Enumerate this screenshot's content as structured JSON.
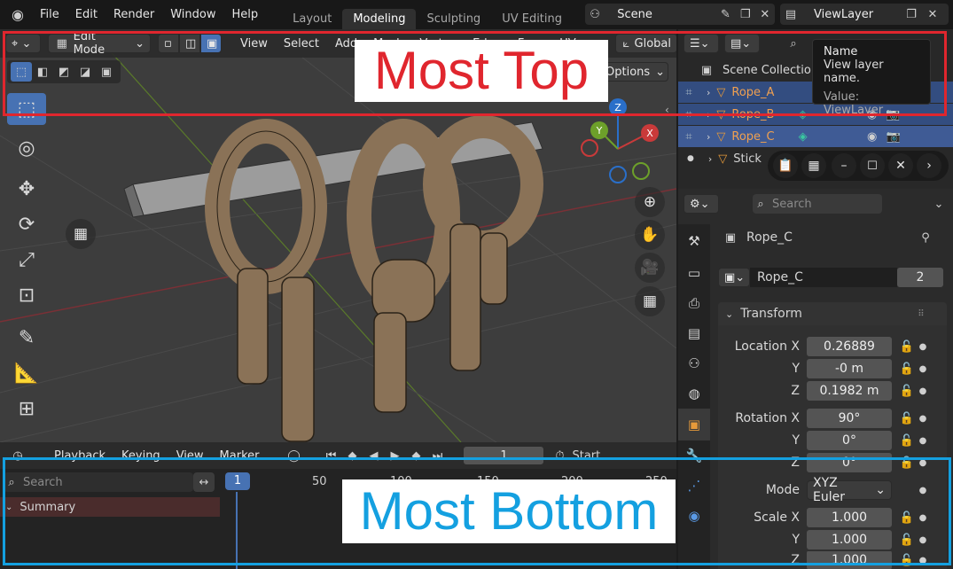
{
  "topbar": {
    "menus": [
      "File",
      "Edit",
      "Render",
      "Window",
      "Help"
    ],
    "workspace_tabs": [
      "Layout",
      "Modeling",
      "Sculpting",
      "UV Editing"
    ],
    "active_tab": "Modeling",
    "scene_name": "Scene",
    "view_layer_name": "ViewLayer"
  },
  "viewport_header": {
    "mode": "Edit Mode",
    "menus": [
      "View",
      "Select",
      "Add",
      "Mesh",
      "Vertex",
      "Edge",
      "Face",
      "UV"
    ],
    "transform_orientation": "Global",
    "options_label": "Options"
  },
  "annotations": {
    "top_label": "Most Top",
    "bottom_label": "Most Bottom",
    "top_color": "#e0262e",
    "bottom_color": "#14a0e0"
  },
  "timeline": {
    "menus": [
      "Playback",
      "Keying",
      "View",
      "Marker"
    ],
    "current_frame": "1",
    "start_label": "Start",
    "search_placeholder": "Search",
    "summary_label": "Summary",
    "ruler": [
      "1",
      "50",
      "100",
      "150",
      "200",
      "250"
    ]
  },
  "outliner": {
    "scene_collection": "Scene Collection",
    "items": [
      {
        "name": "Rope_A",
        "selected": true
      },
      {
        "name": "Rope_B",
        "selected": true
      },
      {
        "name": "Rope_C",
        "selected": true,
        "active": true
      },
      {
        "name": "Stick",
        "selected": false
      }
    ],
    "tooltip": {
      "title": "Name",
      "description": "View layer name.",
      "value": "Value: ViewLayer"
    }
  },
  "properties": {
    "search_placeholder": "Search",
    "object_name": "Rope_C",
    "mesh_name": "Rope_C",
    "mesh_users": "2",
    "panel_title": "Transform",
    "location": {
      "label_x": "Location X",
      "x": "0.26889",
      "y": "-0 m",
      "z": "0.1982 m"
    },
    "rotation": {
      "label_x": "Rotation X",
      "x": "90°",
      "y": "0°",
      "z": "0°"
    },
    "mode_label": "Mode",
    "mode_value": "XYZ Euler",
    "scale": {
      "label_x": "Scale X",
      "x": "1.000",
      "y": "1.000",
      "z": "1.000"
    },
    "axis_y": "Y",
    "axis_z": "Z"
  },
  "gizmo": {
    "x": "X",
    "y": "Y",
    "z": "Z"
  }
}
